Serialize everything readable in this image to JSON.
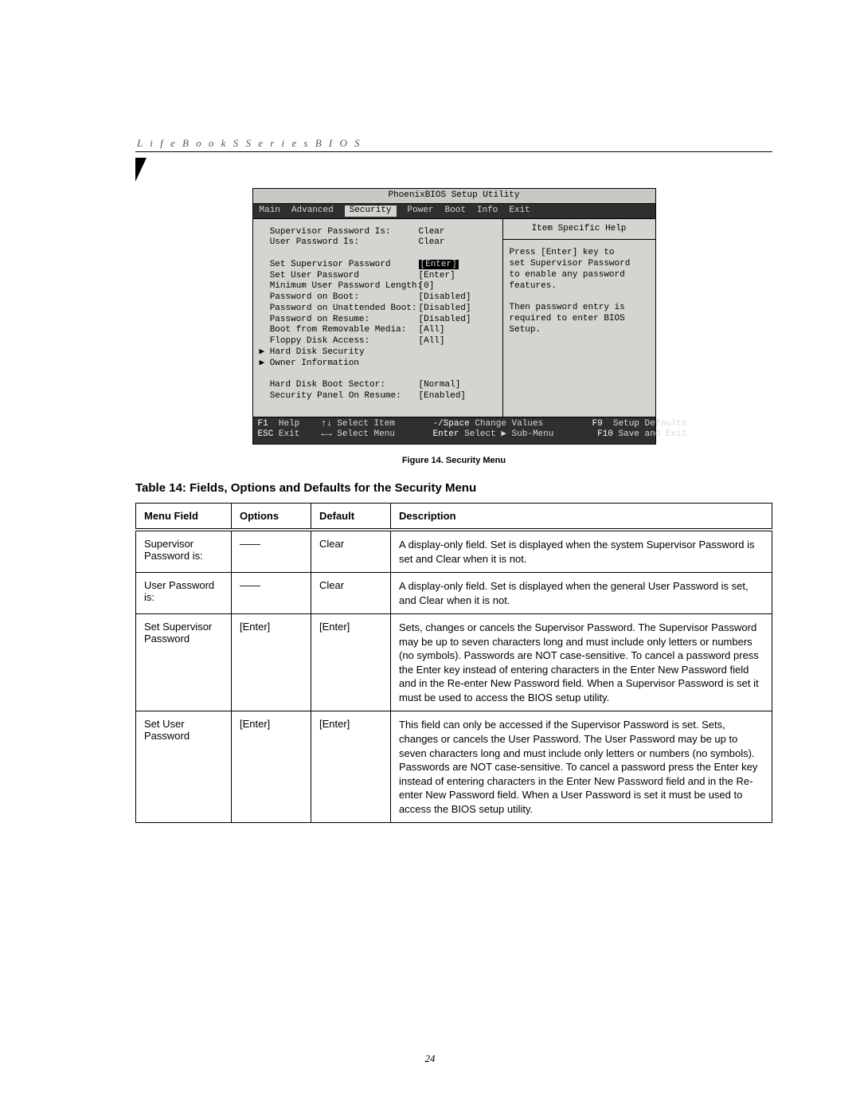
{
  "running_head": "L i f e B o o k   S   S e r i e s   B I O S",
  "bios": {
    "title": "PhoenixBIOS Setup Utility",
    "tabs": [
      "Main",
      "Advanced",
      "Security",
      "Power",
      "Boot",
      "Info",
      "Exit"
    ],
    "active_tab": "Security",
    "rows": [
      {
        "label": "Supervisor Password Is:",
        "value": "Clear"
      },
      {
        "label": "User Password Is:",
        "value": "Clear"
      },
      {
        "label": "",
        "value": ""
      },
      {
        "label": "Set Supervisor Password",
        "value": "[Enter]",
        "hl": true
      },
      {
        "label": "Set User Password",
        "value": "[Enter]"
      },
      {
        "label": "Minimum User Password Length:",
        "value": "[0]"
      },
      {
        "label": "Password on Boot:",
        "value": "[Disabled]"
      },
      {
        "label": "Password on Unattended Boot:",
        "value": "[Disabled]"
      },
      {
        "label": "Password on Resume:",
        "value": "[Disabled]"
      },
      {
        "label": "Boot from Removable Media:",
        "value": "[All]"
      },
      {
        "label": "Floppy Disk Access:",
        "value": "[All]"
      },
      {
        "label": "Hard Disk Security",
        "value": "",
        "submenu": true
      },
      {
        "label": "Owner Information",
        "value": "",
        "submenu": true
      },
      {
        "label": "",
        "value": ""
      },
      {
        "label": "Hard Disk Boot Sector:",
        "value": "[Normal]"
      },
      {
        "label": "Security Panel On Resume:",
        "value": "[Enabled]"
      }
    ],
    "help_title": "Item Specific Help",
    "help_lines": [
      "Press [Enter] key to",
      "set Supervisor Password",
      "to enable any password",
      "features.",
      "",
      "Then password entry is",
      "required to enter BIOS",
      "Setup."
    ],
    "footer": {
      "f1": "F1",
      "f1t": "Help",
      "arrows_v": "↑↓",
      "sel_item": "Select Item",
      "chg": "-/Space",
      "chg_t": "Change Values",
      "f9": "F9",
      "f9t": "Setup Defaults",
      "esc": "ESC",
      "esc_t": "Exit",
      "arrows_h": "←→",
      "sel_menu": "Select Menu",
      "enter": "Enter",
      "enter_t": "Select ▶ Sub-Menu",
      "f10": "F10",
      "f10t": "Save and Exit"
    }
  },
  "figure_caption": "Figure 14.   Security Menu",
  "table_caption": "Table 14: Fields, Options and Defaults for the Security Menu",
  "table": {
    "headers": [
      "Menu Field",
      "Options",
      "Default",
      "Description"
    ],
    "rows": [
      {
        "field": "Supervisor Password is:",
        "options": "——",
        "default": "Clear",
        "desc": "A display-only field. Set is displayed when the system Supervisor Password is set and Clear when it is not."
      },
      {
        "field": "User Password is:",
        "options": "——",
        "default": "Clear",
        "desc": "A display-only field. Set is displayed when the general User Password is set, and Clear when it is not."
      },
      {
        "field": "Set Supervisor Password",
        "options": "[Enter]",
        "default": "[Enter]",
        "desc": "Sets, changes or cancels the Supervisor Password. The Supervisor Password may be up to seven characters long and must include only letters or numbers (no symbols). Passwords are NOT case-sensitive. To cancel a password press the Enter key instead of entering characters in the Enter New Password field and in the Re-enter New Password field. When a Supervisor Password is set it must be used to access the BIOS setup utility."
      },
      {
        "field": "Set User Password",
        "options": "[Enter]",
        "default": "[Enter]",
        "desc": "This field can only be accessed if the Supervisor Password is set. Sets, changes or cancels the User Password. The User Password may be up to seven characters long and must include only letters or numbers (no symbols). Passwords are NOT case-sensitive. To cancel a password press the Enter key instead of entering characters in the Enter New Password field and in the Re-enter New Password field. When a User Password is set it must be used to access the BIOS setup utility."
      }
    ]
  },
  "page_number": "24"
}
